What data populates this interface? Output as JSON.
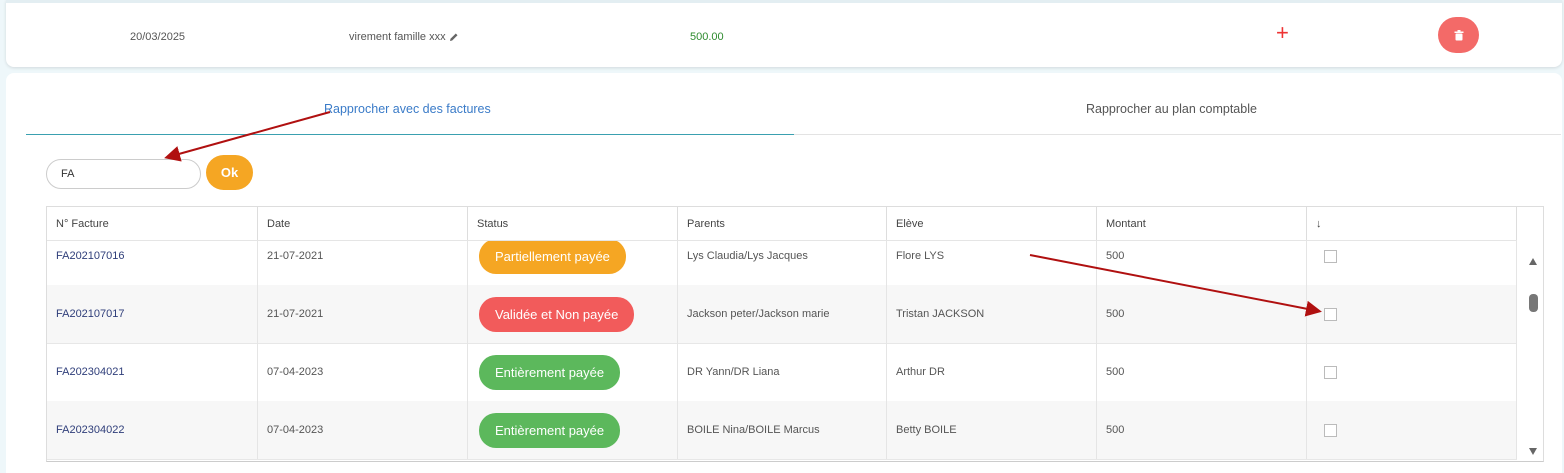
{
  "transaction": {
    "date": "20/03/2025",
    "label": "virement famille xxx",
    "amount": "500.00"
  },
  "tabs": [
    {
      "label": "Rapprocher avec des factures",
      "active": true
    },
    {
      "label": "Rapprocher au plan comptable",
      "active": false
    }
  ],
  "search": {
    "value": "FA",
    "ok_label": "Ok"
  },
  "table": {
    "headers": [
      "N° Facture",
      "Date",
      "Status",
      "Parents",
      "Elève",
      "Montant",
      "↓"
    ],
    "rows": [
      {
        "invoice": "FA202107016",
        "date": "21-07-2021",
        "status": "Partiellement payée",
        "status_color": "#f5a623",
        "parents": "Lys Claudia/Lys Jacques",
        "student": "Flore LYS",
        "amount": "500"
      },
      {
        "invoice": "FA202107017",
        "date": "21-07-2021",
        "status": "Validée et Non payée",
        "status_color": "#f25b5b",
        "parents": "Jackson peter/Jackson marie",
        "student": "Tristan JACKSON",
        "amount": "500"
      },
      {
        "invoice": "FA202304021",
        "date": "07-04-2023",
        "status": "Entièrement payée",
        "status_color": "#5cb85c",
        "parents": "DR Yann/DR Liana",
        "student": "Arthur DR",
        "amount": "500"
      },
      {
        "invoice": "FA202304022",
        "date": "07-04-2023",
        "status": "Entièrement payée",
        "status_color": "#5cb85c",
        "parents": "BOILE Nina/BOILE Marcus",
        "student": "Betty BOILE",
        "amount": "500"
      }
    ]
  },
  "colors": {
    "accent": "#3a7bc8",
    "ok_button": "#f5a623",
    "delete_button": "#f36a68",
    "annotation_arrow": "#b01010"
  },
  "icons": [
    "pencil-icon",
    "plus-icon",
    "trash-icon",
    "arrow-down-icon",
    "scroll-up-icon",
    "scroll-down-icon"
  ]
}
